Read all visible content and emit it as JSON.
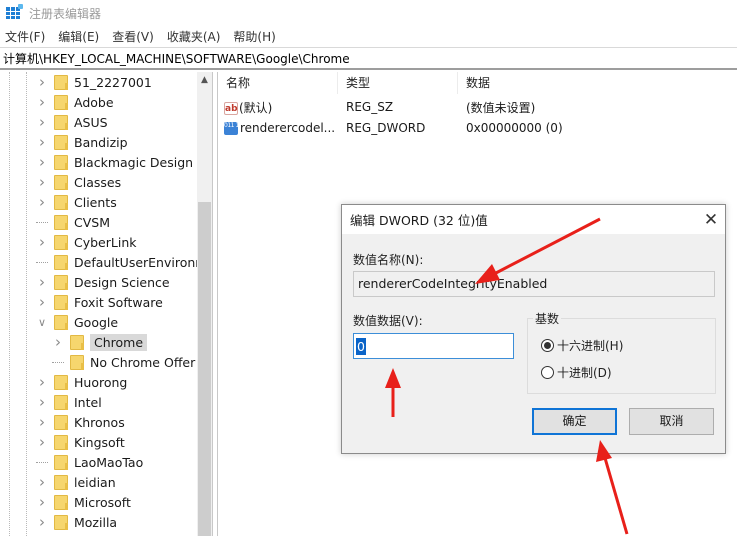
{
  "window": {
    "title": "注册表编辑器",
    "icon": "registry-editor-icon"
  },
  "menu": [
    {
      "label": "文件(F)"
    },
    {
      "label": "编辑(E)"
    },
    {
      "label": "查看(V)"
    },
    {
      "label": "收藏夹(A)"
    },
    {
      "label": "帮助(H)"
    }
  ],
  "address": "计算机\\HKEY_LOCAL_MACHINE\\SOFTWARE\\Google\\Chrome",
  "tree": {
    "items": [
      {
        "label": "51_2227001",
        "expandable": true,
        "level": 0
      },
      {
        "label": "Adobe",
        "expandable": true,
        "level": 0
      },
      {
        "label": "ASUS",
        "expandable": true,
        "level": 0
      },
      {
        "label": "Bandizip",
        "expandable": true,
        "level": 0
      },
      {
        "label": "Blackmagic Design",
        "expandable": true,
        "level": 0
      },
      {
        "label": "Classes",
        "expandable": true,
        "level": 0
      },
      {
        "label": "Clients",
        "expandable": true,
        "level": 0
      },
      {
        "label": "CVSM",
        "expandable": false,
        "level": 0
      },
      {
        "label": "CyberLink",
        "expandable": true,
        "level": 0
      },
      {
        "label": "DefaultUserEnvironme",
        "expandable": false,
        "level": 0
      },
      {
        "label": "Design Science",
        "expandable": true,
        "level": 0
      },
      {
        "label": "Foxit Software",
        "expandable": true,
        "level": 0
      },
      {
        "label": "Google",
        "expandable": true,
        "expanded": true,
        "level": 0
      },
      {
        "label": "Chrome",
        "expandable": true,
        "level": 1,
        "selected": true
      },
      {
        "label": "No Chrome Offer U",
        "expandable": false,
        "level": 1
      },
      {
        "label": "Huorong",
        "expandable": true,
        "level": 0
      },
      {
        "label": "Intel",
        "expandable": true,
        "level": 0
      },
      {
        "label": "Khronos",
        "expandable": true,
        "level": 0
      },
      {
        "label": "Kingsoft",
        "expandable": true,
        "level": 0
      },
      {
        "label": "LaoMaoTao",
        "expandable": false,
        "level": 0
      },
      {
        "label": "leidian",
        "expandable": true,
        "level": 0
      },
      {
        "label": "Microsoft",
        "expandable": true,
        "level": 0
      },
      {
        "label": "Mozilla",
        "expandable": true,
        "level": 0
      }
    ]
  },
  "list": {
    "columns": [
      "名称",
      "类型",
      "数据"
    ],
    "rows": [
      {
        "icon": "string-value-icon",
        "icon_text": "ab",
        "name": "(默认)",
        "type": "REG_SZ",
        "data": "(数值未设置)"
      },
      {
        "icon": "dword-value-icon",
        "icon_text": "011 110",
        "name": "renderercodel...",
        "type": "REG_DWORD",
        "data": "0x00000000 (0)"
      }
    ]
  },
  "dialog": {
    "title": "编辑 DWORD (32 位)值",
    "name_label": "数值名称(N):",
    "name_value": "rendererCodeIntegrityEnabled",
    "data_label": "数值数据(V):",
    "data_value": "0",
    "base_label": "基数",
    "base_options": [
      {
        "label": "十六进制(H)",
        "checked": true
      },
      {
        "label": "十进制(D)",
        "checked": false
      }
    ],
    "ok_label": "确定",
    "cancel_label": "取消",
    "close_glyph": "✕"
  },
  "annotations": {
    "arrow_color": "#e8201a",
    "arrows": [
      "points-to-value-name",
      "points-to-value-data",
      "points-to-ok-button"
    ]
  }
}
